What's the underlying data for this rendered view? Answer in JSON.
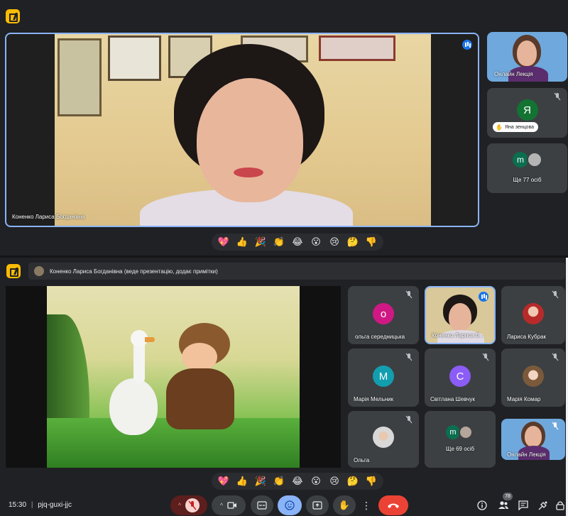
{
  "colors": {
    "bg": "#202124",
    "tile": "#3c4043",
    "accent": "#8ab4f8",
    "hangup": "#ea4335"
  },
  "top": {
    "main_speaker": "Коненко Лариса Богданівна",
    "side_tiles": [
      {
        "name": "Онлайн Лекція"
      },
      {
        "initial": "Я",
        "name": "Яна зенцова",
        "color": "#137333"
      },
      {
        "initial": "m",
        "name": "Ще 77 осіб",
        "color": "#0b6e4f"
      }
    ],
    "reactions": [
      "💖",
      "👍",
      "🎉",
      "👏",
      "😂",
      "😮",
      "😢",
      "🤔",
      "👎"
    ]
  },
  "bottom": {
    "presenter_banner": "Коненко Лариса Богданівна (веде презентацію, додає примітки)",
    "slide_caption": "",
    "grid": [
      {
        "initial": "о",
        "name": "ольга середницька",
        "color": "#d01884"
      },
      {
        "name": "Коненко Лариса Б...",
        "video": true
      },
      {
        "name": "Лариса Кубрак",
        "photo": true
      },
      {
        "initial": "М",
        "name": "Марія Мельник",
        "color": "#129eaf"
      },
      {
        "initial": "С",
        "name": "Світлана Шевчук",
        "color": "#8b5cf6"
      },
      {
        "name": "Марія Комар",
        "photo": true
      },
      {
        "name": "Ольга",
        "photo": true
      },
      {
        "initial": "m",
        "name": "Ще 69 осіб",
        "color": "#0b6e4f"
      },
      {
        "name": "Онлайн Лекція",
        "video": true
      }
    ],
    "reactions": [
      "💖",
      "👍",
      "🎉",
      "👏",
      "😂",
      "😮",
      "😢",
      "🤔",
      "👎"
    ]
  },
  "footer": {
    "time": "15:30",
    "separator": "|",
    "meeting_code": "pjq-guxi-jjc",
    "participants_count": "78"
  }
}
